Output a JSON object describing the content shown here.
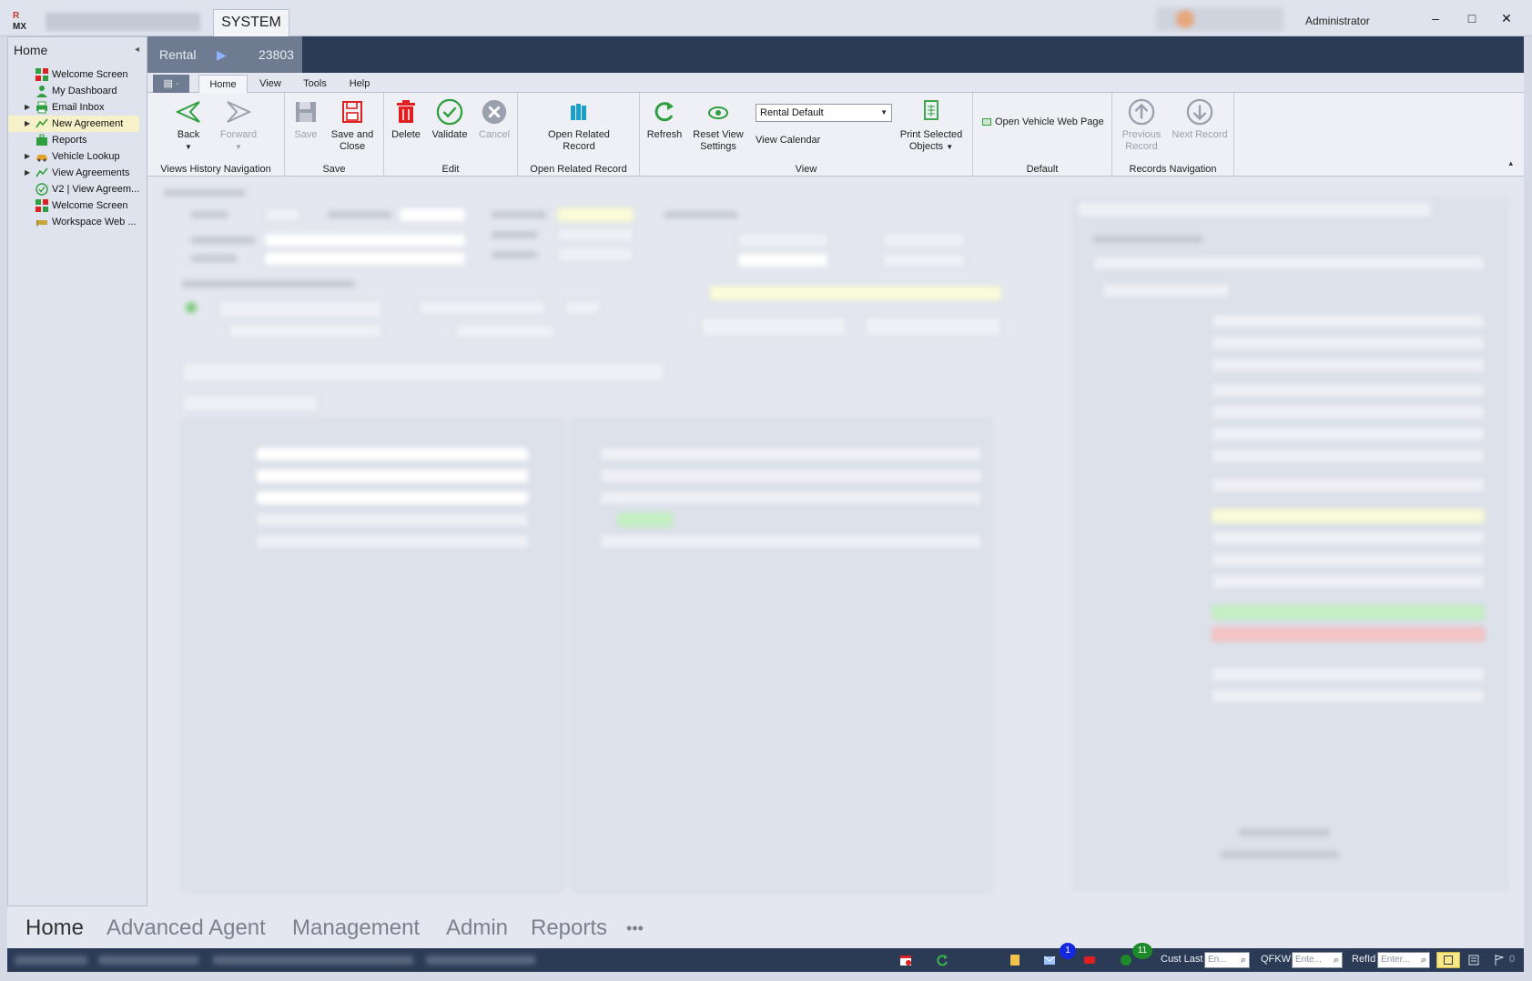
{
  "app": {
    "logo_text_top": "R",
    "logo_text_bottom": "MX",
    "system_tab": "SYSTEM",
    "user": "Administrator",
    "window_controls": {
      "minimize": "–",
      "maximize": "□",
      "close": "✕"
    }
  },
  "leftnav": {
    "title": "Home",
    "collapse_glyph": "◂",
    "items": [
      {
        "label": "Welcome Screen",
        "icon": "welcome-grid-icon",
        "expandable": false
      },
      {
        "label": "My Dashboard",
        "icon": "person-icon",
        "expandable": false
      },
      {
        "label": "Email Inbox",
        "icon": "printer-icon",
        "expandable": true
      },
      {
        "label": "New Agreement",
        "icon": "chart-line-icon",
        "expandable": true,
        "selected": true
      },
      {
        "label": "Reports",
        "icon": "briefcase-icon",
        "expandable": false
      },
      {
        "label": "Vehicle Lookup",
        "icon": "car-icon",
        "expandable": true
      },
      {
        "label": "View Agreements",
        "icon": "chart-line-icon",
        "expandable": true
      },
      {
        "label": "V2 | View Agreem...",
        "icon": "check-circle-icon",
        "expandable": false
      },
      {
        "label": "Welcome Screen",
        "icon": "welcome-grid-icon",
        "expandable": false
      },
      {
        "label": "Workspace Web ...",
        "icon": "flag-icon",
        "expandable": false
      }
    ]
  },
  "document": {
    "type": "Rental",
    "arrow": "▶",
    "record_id": "23803"
  },
  "ribbon": {
    "file_glyph": "▤ ·",
    "tabs": [
      "Home",
      "View",
      "Tools",
      "Help"
    ],
    "active_tab": "Home",
    "groups": {
      "nav": {
        "label": "Views History Navigation",
        "back": "Back",
        "forward": "Forward"
      },
      "save": {
        "label": "Save",
        "save": "Save",
        "save_close": "Save and Close"
      },
      "edit": {
        "label": "Edit",
        "delete": "Delete",
        "validate": "Validate",
        "cancel": "Cancel"
      },
      "related": {
        "label": "Open Related Record",
        "open_related": "Open Related Record"
      },
      "view": {
        "label": "View",
        "refresh": "Refresh",
        "reset_view": "Reset View Settings",
        "layout_value": "Rental Default",
        "view_calendar": "View Calendar",
        "print_selected": "Print Selected Objects"
      },
      "default": {
        "label": "Default",
        "open_vehicle_web": "Open Vehicle Web Page"
      },
      "records": {
        "label": "Records Navigation",
        "previous": "Previous Record",
        "next": "Next Record"
      }
    },
    "collapse_glyph": "▴"
  },
  "bottomnav": {
    "items": [
      "Home",
      "Advanced Agent",
      "Management",
      "Admin",
      "Reports"
    ],
    "active": "Home",
    "more": "•••"
  },
  "statusbar": {
    "badges": {
      "mail_count": "1",
      "chat_count": "11"
    },
    "cust_last": {
      "label": "Cust Last",
      "placeholder": "En..."
    },
    "qfkw": {
      "label": "QFKW",
      "placeholder": "Ente..."
    },
    "refid": {
      "label": "RefId",
      "placeholder": "Enter..."
    },
    "notification_count": "0"
  },
  "colors": {
    "doc_bar": "#2b3b55",
    "accent_green": "#2e9e3e",
    "delete_red": "#e02020",
    "badge_blue": "#1428e0",
    "badge_green": "#1d8a2a"
  }
}
